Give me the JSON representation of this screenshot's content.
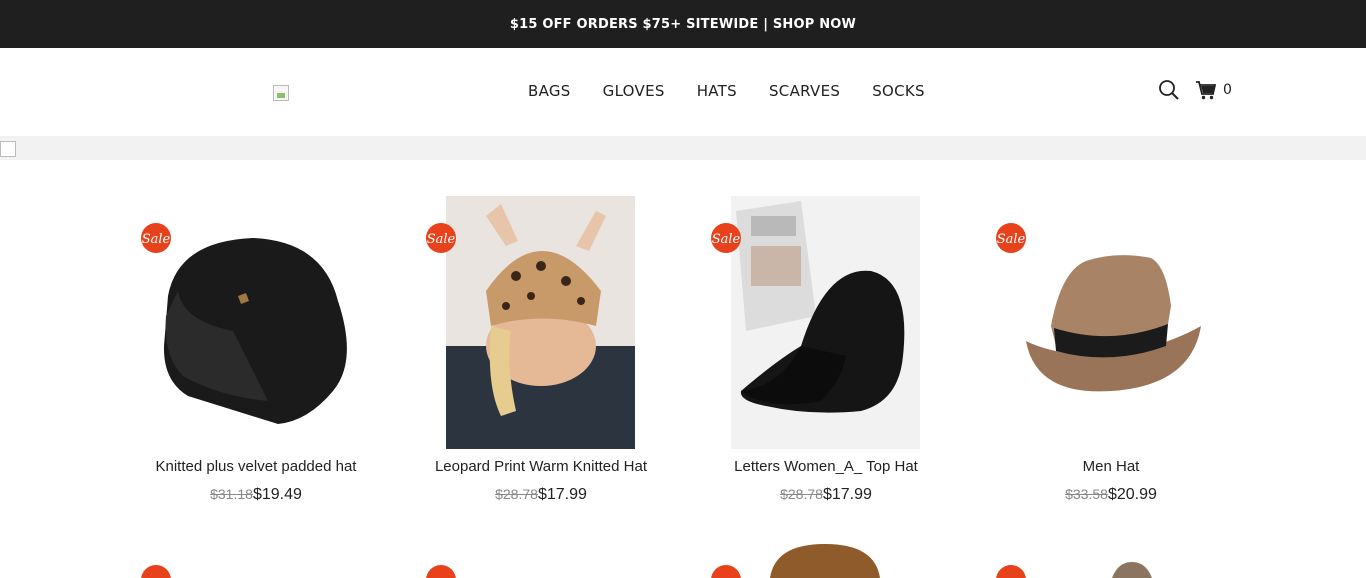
{
  "announcement": "$15 OFF ORDERS $75+ SITEWIDE | SHOP NOW",
  "nav": [
    "BAGS",
    "GLOVES",
    "HATS",
    "SCARVES",
    "SOCKS"
  ],
  "cart": {
    "count": "0"
  },
  "badge": "Sale",
  "colors": {
    "topbar": "#1f1f1f",
    "badge": "#e8421c"
  },
  "products": [
    {
      "title": "Knitted plus velvet padded hat",
      "old_price": "$31.18",
      "price": "$19.49"
    },
    {
      "title": "Leopard Print Warm Knitted Hat",
      "old_price": "$28.78",
      "price": "$17.99"
    },
    {
      "title": "Letters Women_A_ Top Hat",
      "old_price": "$28.78",
      "price": "$17.99"
    },
    {
      "title": "Men Hat",
      "old_price": "$33.58",
      "price": "$20.99"
    }
  ]
}
